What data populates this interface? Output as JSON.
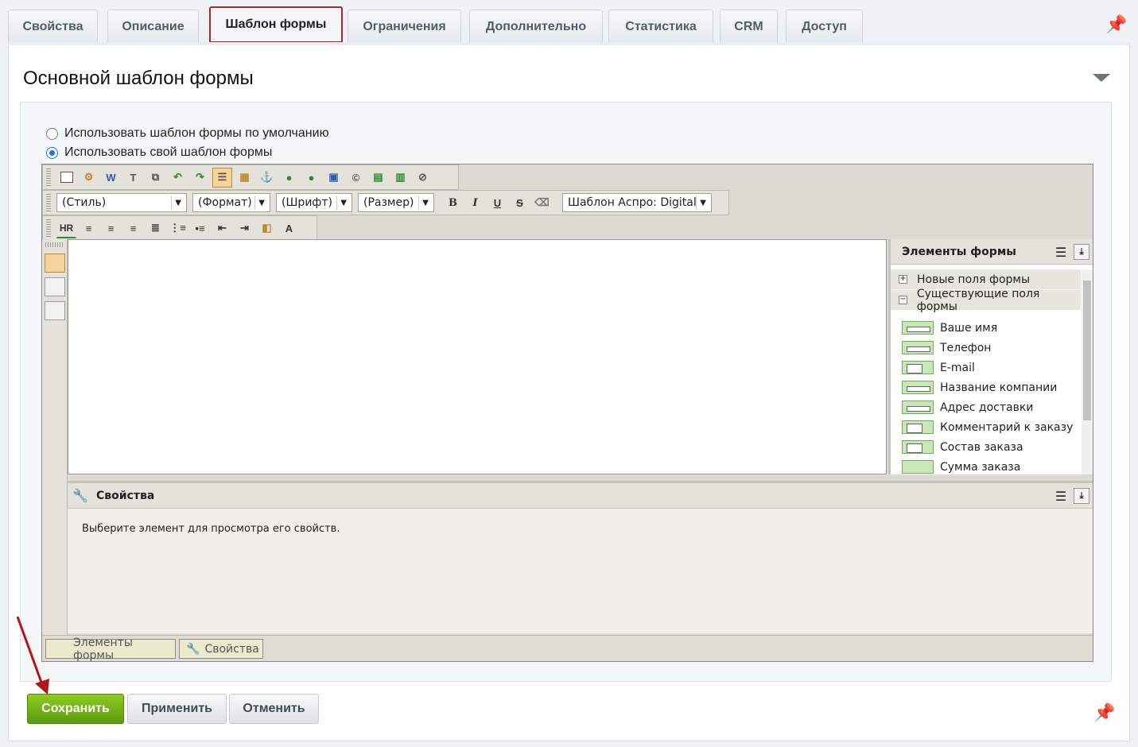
{
  "tabs": [
    {
      "label": "Свойства"
    },
    {
      "label": "Описание"
    },
    {
      "label": "Шаблон формы",
      "active": true
    },
    {
      "label": "Ограничения"
    },
    {
      "label": "Дополнительно"
    },
    {
      "label": "Статистика"
    },
    {
      "label": "CRM"
    },
    {
      "label": "Доступ"
    }
  ],
  "section": {
    "title": "Основной шаблон формы",
    "radio_default": "Использовать шаблон формы по умолчанию",
    "radio_custom": "Использовать свой шаблон формы",
    "selected_option": "custom"
  },
  "toolbar": {
    "style_select": "(Стиль)",
    "format_select": "(Формат)",
    "font_select": "(Шрифт)",
    "size_select": "(Размер)",
    "template_select": "Шаблон Аспро: Digital-кс",
    "hr_label": "HR",
    "bold_label": "B",
    "italic_label": "I",
    "underline_label": "U",
    "strike_label": "S"
  },
  "form_elements": {
    "title": "Элементы формы",
    "group_new": "Новые поля формы",
    "group_existing": "Существующие поля формы",
    "fields": [
      {
        "label": "Ваше имя",
        "icon": "text-field-icon"
      },
      {
        "label": "Телефон",
        "icon": "text-field-icon"
      },
      {
        "label": "E-mail",
        "icon": "email-field-icon"
      },
      {
        "label": "Название компании",
        "icon": "text-field-icon"
      },
      {
        "label": "Адрес доставки",
        "icon": "text-field-icon"
      },
      {
        "label": "Комментарий к заказу",
        "icon": "textarea-field-icon"
      },
      {
        "label": "Состав заказа",
        "icon": "textarea-field-icon"
      },
      {
        "label": "Сумма заказа",
        "icon": "hidden-field-icon"
      }
    ]
  },
  "properties": {
    "title": "Свойства",
    "hint": "Выберите элемент для просмотра его свойств."
  },
  "bottom_tabs": {
    "elements": "Элементы формы",
    "properties": "Свойства"
  },
  "buttons": {
    "save": "Сохранить",
    "apply": "Применить",
    "cancel": "Отменить"
  },
  "colors": {
    "save_button": "#6fb218",
    "active_tab_border": "#a52a2a",
    "arrow": "#b01818"
  }
}
